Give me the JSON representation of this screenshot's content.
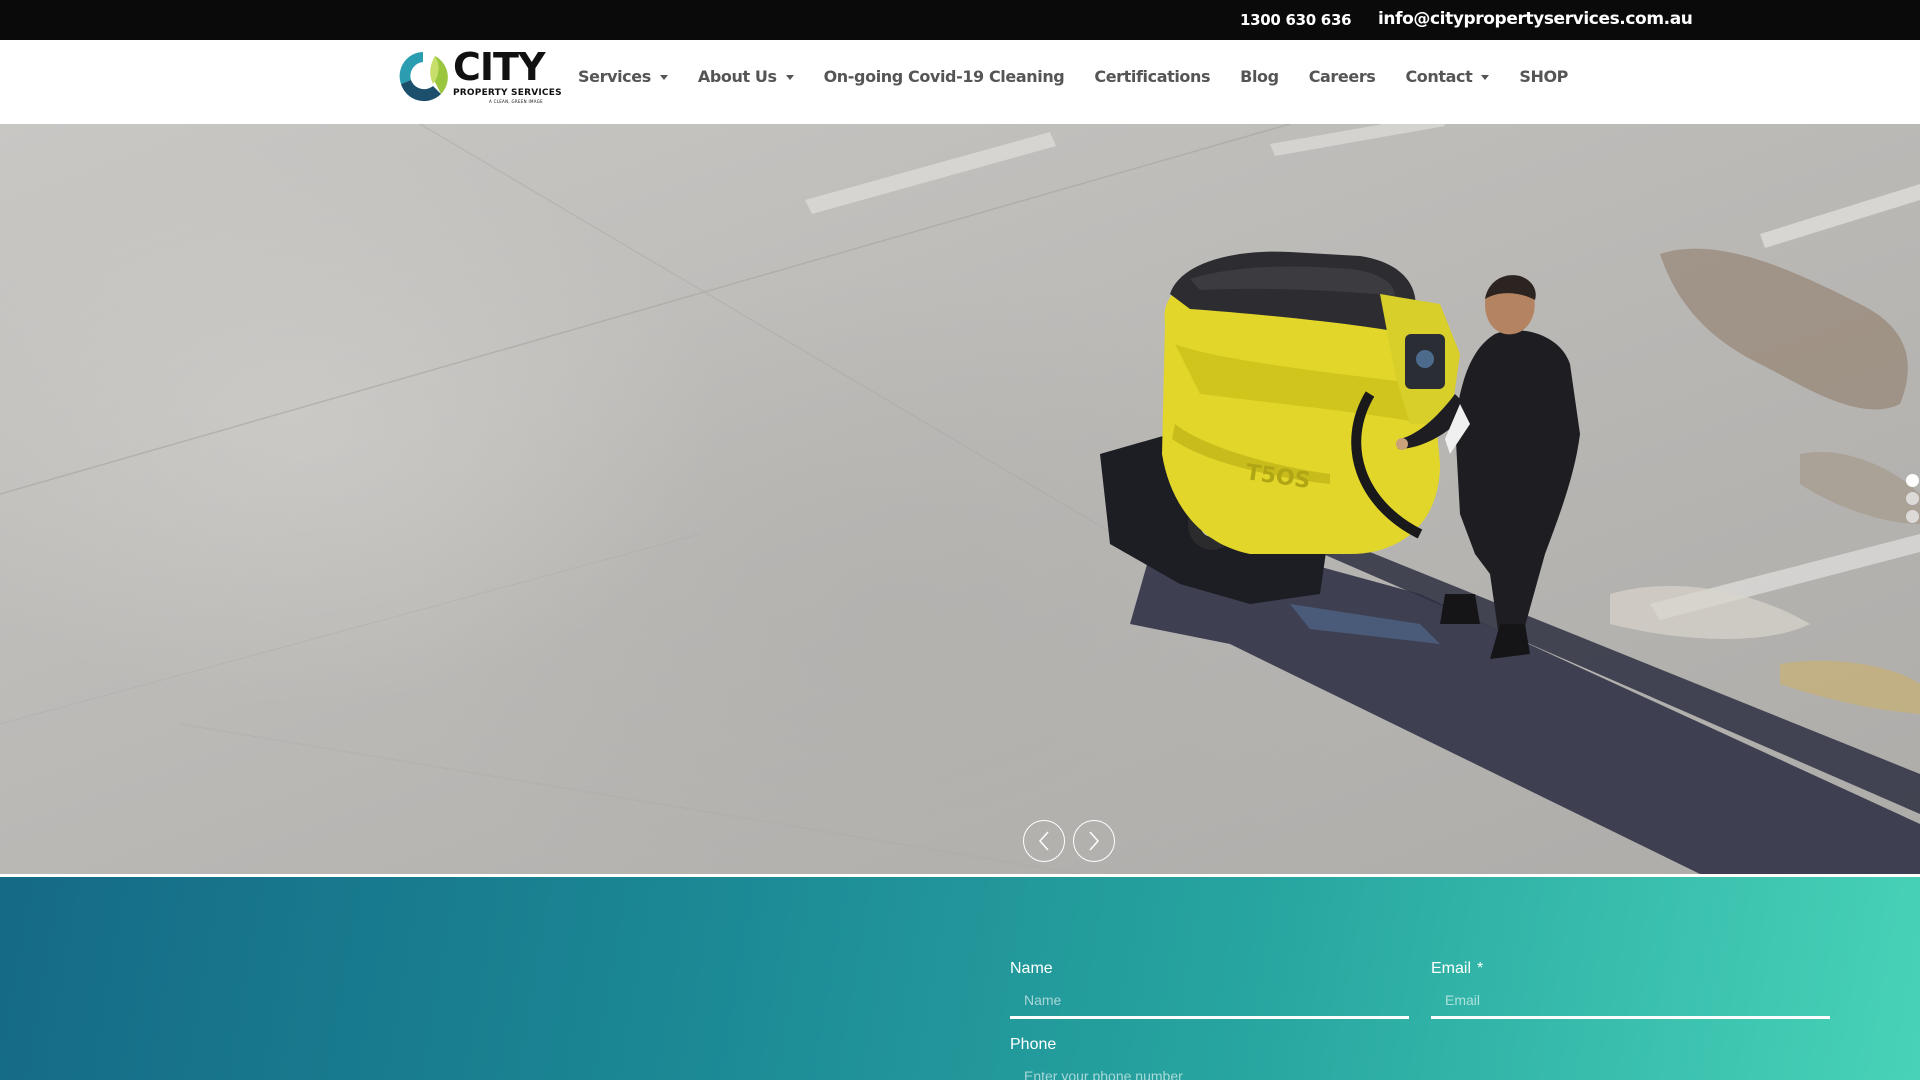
{
  "topbar": {
    "phone": "1300 630 636",
    "email": "info@citypropertyservices.com.au"
  },
  "logo": {
    "word": "CITY",
    "sub": "PROPERTY SERVICES",
    "tag": "A CLEAN, GREEN IMAGE"
  },
  "nav": {
    "items": [
      {
        "label": "Services",
        "dropdown": true
      },
      {
        "label": "About Us",
        "dropdown": true
      },
      {
        "label": "On-going Covid-19 Cleaning",
        "dropdown": false
      },
      {
        "label": "Certifications",
        "dropdown": false
      },
      {
        "label": "Blog",
        "dropdown": false
      },
      {
        "label": "Careers",
        "dropdown": false
      },
      {
        "label": "Contact",
        "dropdown": true
      },
      {
        "label": "SHOP",
        "dropdown": false
      }
    ]
  },
  "slider": {
    "slide_count": 3,
    "active_slide": 1,
    "prev_icon": "chevron-left-icon",
    "next_icon": "chevron-right-icon"
  },
  "form": {
    "name_label": "Name",
    "name_placeholder": "Name",
    "email_label": "Email",
    "email_required": "*",
    "email_placeholder": "Email",
    "phone_label": "Phone",
    "phone_placeholder": "Enter your phone number"
  },
  "colors": {
    "topbar_bg": "#0a0a0a",
    "nav_text": "#555555",
    "form_gradient_start": "#156a86",
    "form_gradient_end": "#48d3b8",
    "machine_yellow": "#e2d62a"
  }
}
